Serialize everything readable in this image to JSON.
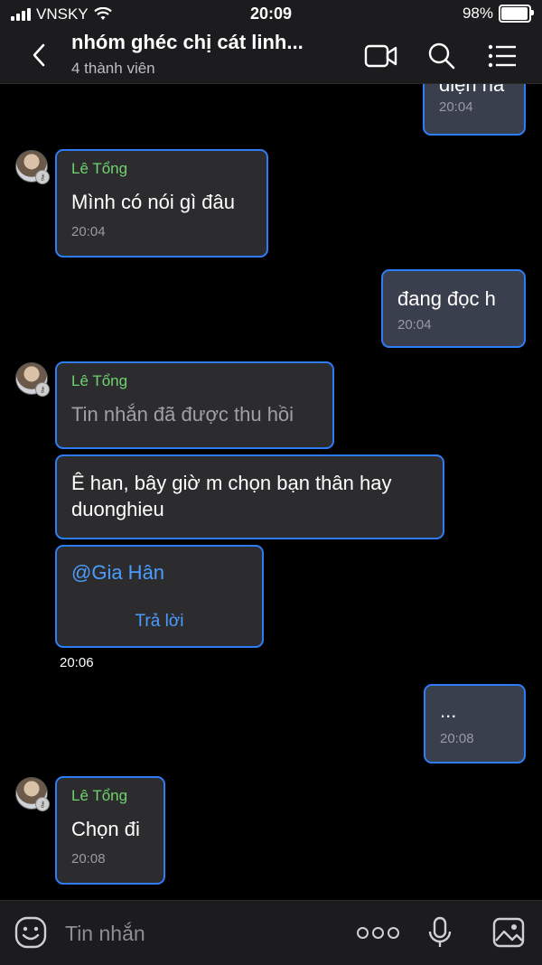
{
  "status": {
    "carrier": "VNSKY",
    "time": "20:09",
    "battery": "98%"
  },
  "header": {
    "title": "nhóm ghéc chị cát linh...",
    "subtitle": "4 thành viên"
  },
  "messages": [
    {
      "text": "điện ha",
      "time": "20:04"
    },
    {
      "sender": "Lê Tổng",
      "text": "Mình có nói gì đâu",
      "time": "20:04"
    },
    {
      "text": "đang đọc h",
      "time": "20:04"
    },
    {
      "sender": "Lê Tổng",
      "text": "Tin nhắn đã được thu hồi"
    },
    {
      "text": "Ê han, bây giờ m chọn bạn thân hay duonghieu"
    },
    {
      "mention": "@Gia Hân",
      "reply": "Trả lời",
      "time": "20:06"
    },
    {
      "text": "...",
      "time": "20:08"
    },
    {
      "sender": "Lê Tổng",
      "text": "Chọn đi",
      "time": "20:08"
    }
  ],
  "composer": {
    "placeholder": "Tin nhắn"
  },
  "icons": {
    "back": "chevron-left-icon",
    "video": "video-camera-icon",
    "search": "search-icon",
    "menu": "list-menu-icon",
    "emoji": "emoji-icon",
    "more": "more-dots-icon",
    "mic": "microphone-icon",
    "image": "image-icon"
  },
  "colors": {
    "bubble_border": "#2f7df6",
    "sender": "#6fd36f",
    "link": "#4a9cff"
  }
}
